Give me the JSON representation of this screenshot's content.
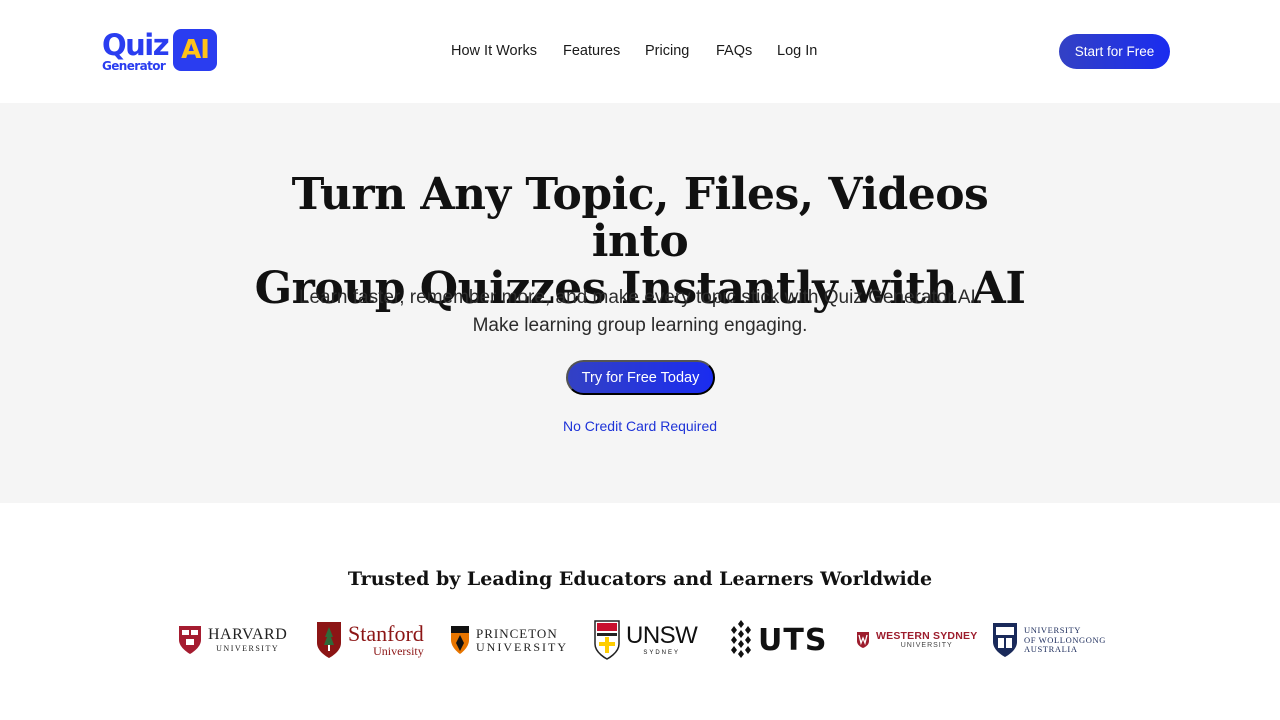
{
  "logo": {
    "line1": "Quiz",
    "line2": "Generator",
    "badge": "AI",
    "colors": {
      "primary": "#2a3df0",
      "badge_text": "#ffc21a"
    }
  },
  "nav": {
    "items": [
      "How It Works",
      "Features",
      "Pricing",
      "FAQs",
      "Log In"
    ]
  },
  "header": {
    "cta_label": "Start for Free"
  },
  "hero": {
    "title_line1": "Turn Any Topic, Files, Videos into",
    "title_line2": "Group Quizzes Instantly with AI",
    "subtitle_line1": "Learn faster, remember more, and make every topic stick with Quiz Generator AI.",
    "subtitle_line2": "Make learning group learning engaging.",
    "cta_label": "Try for Free Today",
    "note": "No Credit Card Required"
  },
  "trusted": {
    "title": "Trusted by Leading Educators and Learners Worldwide",
    "logos": {
      "harvard": {
        "name": "HARVARD",
        "sub": "UNIVERSITY"
      },
      "stanford": {
        "name": "Stanford",
        "sub": "University"
      },
      "princeton": {
        "name": "PRINCETON",
        "sub": "UNIVERSITY"
      },
      "unsw": {
        "name": "UNSW",
        "sub": "SYDNEY"
      },
      "uts": {
        "name": "UTS"
      },
      "western_sydney": {
        "name": "WESTERN SYDNEY",
        "sub": "UNIVERSITY"
      },
      "wollongong": {
        "line1": "UNIVERSITY",
        "line2": "OF WOLLONGONG",
        "line3": "AUSTRALIA"
      }
    }
  },
  "colors": {
    "accent": "#1a2cf0",
    "hero_bg": "#f5f5f5",
    "link": "#1e33d8"
  }
}
